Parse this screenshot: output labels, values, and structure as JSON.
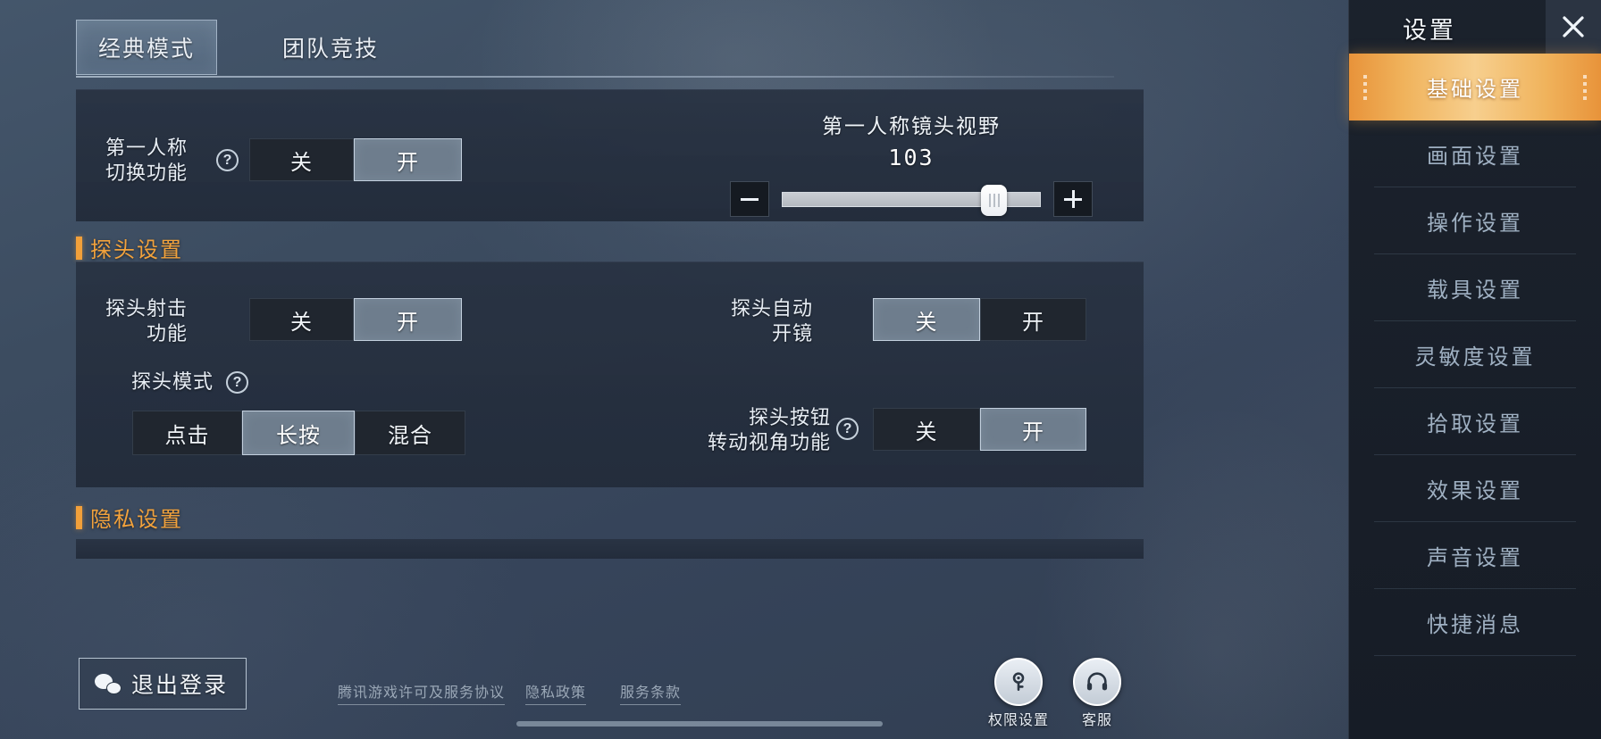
{
  "tabs": [
    {
      "label": "经典模式",
      "active": true
    },
    {
      "label": "团队竞技",
      "active": false
    }
  ],
  "section_first_person": {
    "row": {
      "label_line1": "第一人称",
      "label_line2": "切换功能",
      "help_icon": "question-mark-icon",
      "options": [
        "关",
        "开"
      ],
      "selected": "开"
    },
    "fov": {
      "title": "第一人称镜头视野",
      "value": "103",
      "minus_label": "−",
      "plus_label": "+",
      "slider_percent": 78
    }
  },
  "section_peek": {
    "heading": "探头设置",
    "shoot_row": {
      "label_line1": "探头射击",
      "label_line2": "功能",
      "options": [
        "关",
        "开"
      ],
      "selected": "开"
    },
    "auto_scope_row": {
      "label_line1": "探头自动",
      "label_line2": "开镜",
      "options": [
        "关",
        "开"
      ],
      "selected": "关"
    },
    "mode_row": {
      "label": "探头模式",
      "help_icon": "question-mark-icon",
      "options": [
        "点击",
        "长按",
        "混合"
      ],
      "selected": "长按"
    },
    "button_rotate_row": {
      "label_line1": "探头按钮",
      "label_line2": "转动视角功能",
      "help_icon": "question-mark-icon",
      "options": [
        "关",
        "开"
      ],
      "selected": "开"
    }
  },
  "section_privacy": {
    "heading": "隐私设置"
  },
  "bottom": {
    "logout_label": "退出登录",
    "logout_icon": "wechat-icon",
    "links": [
      "腾讯游戏许可及服务协议",
      "隐私政策",
      "服务条款"
    ],
    "round_buttons": [
      {
        "caption": "权限设置",
        "icon": "permission-key-icon"
      },
      {
        "caption": "客服",
        "icon": "headset-support-icon"
      }
    ]
  },
  "sidebar": {
    "title": "设置",
    "close_icon": "close-icon",
    "items": [
      {
        "label": "基础设置",
        "active": true
      },
      {
        "label": "画面设置",
        "active": false
      },
      {
        "label": "操作设置",
        "active": false
      },
      {
        "label": "载具设置",
        "active": false
      },
      {
        "label": "灵敏度设置",
        "active": false
      },
      {
        "label": "拾取设置",
        "active": false
      },
      {
        "label": "效果设置",
        "active": false
      },
      {
        "label": "声音设置",
        "active": false
      },
      {
        "label": "快捷消息",
        "active": false
      }
    ]
  },
  "colors": {
    "accent_orange": "#f2a03a",
    "panel_bg": "#2a3442",
    "toggle_off_bg": "#20262f",
    "toggle_on_bg": "#6e7d8d"
  }
}
